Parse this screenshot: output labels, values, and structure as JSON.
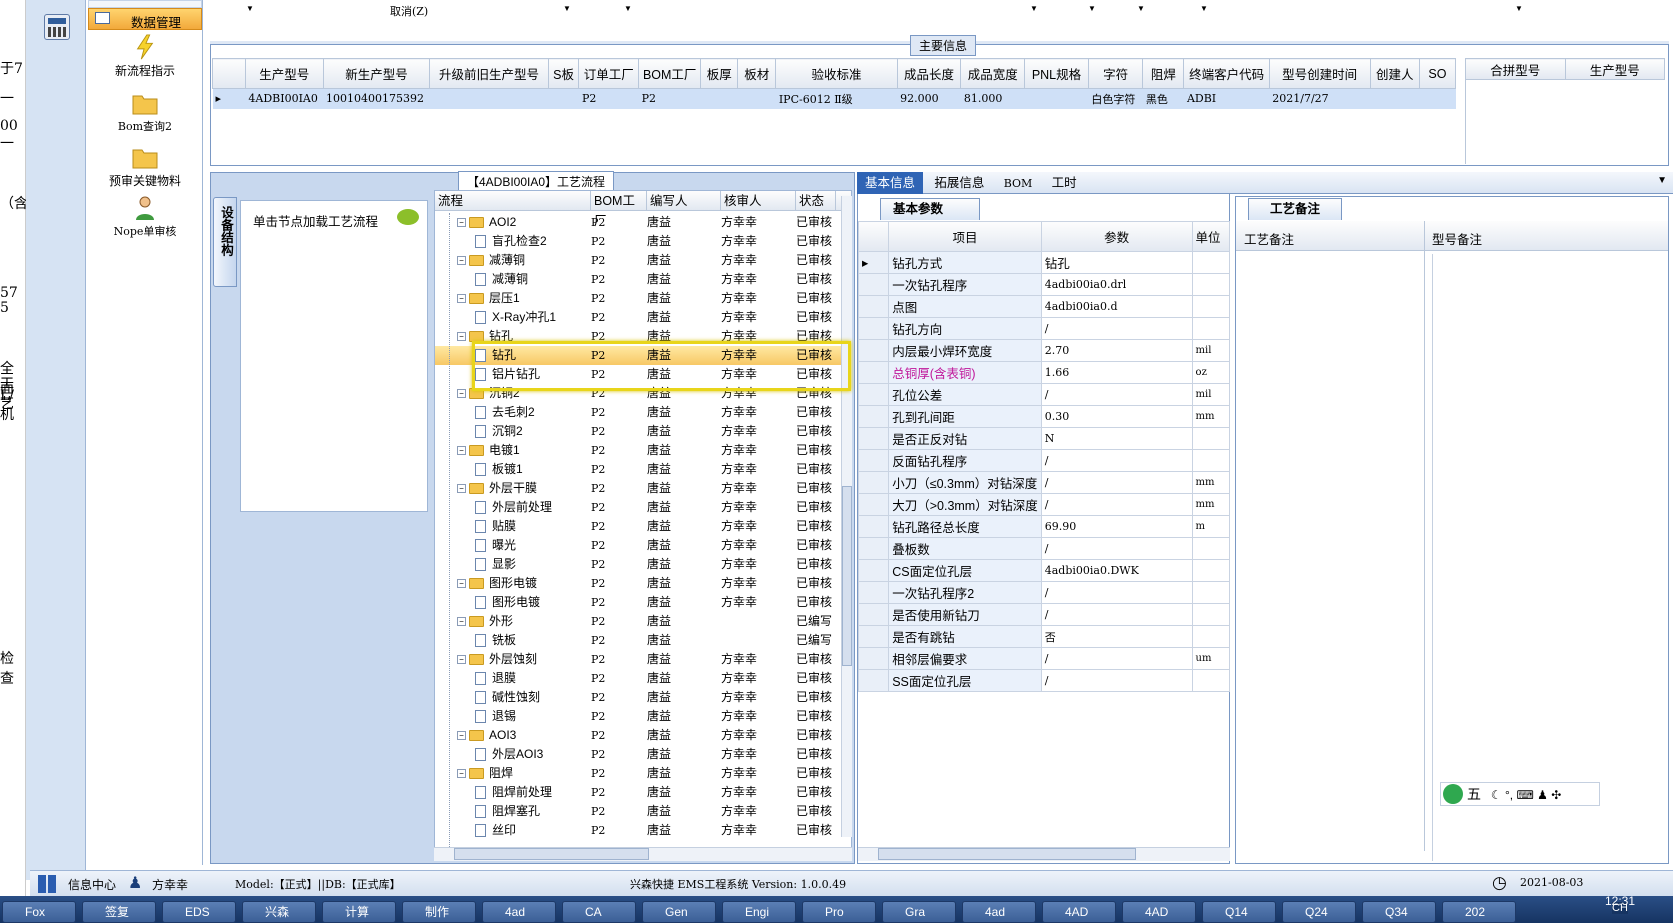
{
  "left_strip": [
    "于7",
    "一",
    "00",
    "一",
    "（含",
    "57",
    "5",
    "全面",
    "工艺",
    "L/机",
    "检查"
  ],
  "nav": {
    "active": "数据管理",
    "items": [
      "新流程指示",
      "Bom查询2",
      "预审关键物料",
      "Nope单审核"
    ]
  },
  "toolbar": {
    "cancel": "取消(Z)"
  },
  "main_info": {
    "title": "主要信息",
    "headers": [
      "生产型号",
      "新生产型号",
      "升级前旧生产型号",
      "S板",
      "订单工厂",
      "BOM工厂",
      "板厚",
      "板材",
      "验收标准",
      "成品长度",
      "成品宽度",
      "PNL规格",
      "字符",
      "阻焊",
      "终端客户代码",
      "型号创建时间",
      "创建人",
      "SO"
    ],
    "row": [
      "4ADBI00IA0",
      "10010400175392",
      "",
      "",
      "P2",
      "P2",
      "",
      "",
      "IPC-6012 Ⅱ级",
      "92.000",
      "81.000",
      "",
      "白色字符",
      "黑色",
      "ADBI",
      "2021/7/27",
      "",
      ""
    ],
    "side_headers": [
      "合拼型号",
      "生产型号"
    ]
  },
  "process": {
    "title": "【4ADBI00IA0】工艺流程",
    "side_tab": "设备结构",
    "hint": "单击节点加载工艺流程",
    "headers": [
      "流程",
      "BOM工厂",
      "编写人",
      "核审人",
      "状态"
    ],
    "rows": [
      {
        "name": "AOI2",
        "level": 1,
        "bom": "P2",
        "writer": "唐益",
        "checker": "方幸幸",
        "status": "已审核"
      },
      {
        "name": "盲孔检查2",
        "level": 2,
        "bom": "P2",
        "writer": "唐益",
        "checker": "方幸幸",
        "status": "已审核"
      },
      {
        "name": "减薄铜",
        "level": 1,
        "bom": "P2",
        "writer": "唐益",
        "checker": "方幸幸",
        "status": "已审核"
      },
      {
        "name": "减薄铜",
        "level": 2,
        "bom": "P2",
        "writer": "唐益",
        "checker": "方幸幸",
        "status": "已审核"
      },
      {
        "name": "层压1",
        "level": 1,
        "bom": "P2",
        "writer": "唐益",
        "checker": "方幸幸",
        "status": "已审核"
      },
      {
        "name": "X-Ray冲孔1",
        "level": 2,
        "bom": "P2",
        "writer": "唐益",
        "checker": "方幸幸",
        "status": "已审核"
      },
      {
        "name": "钻孔",
        "level": 1,
        "bom": "P2",
        "writer": "唐益",
        "checker": "方幸幸",
        "status": "已审核"
      },
      {
        "name": "钻孔",
        "level": 2,
        "bom": "P2",
        "writer": "唐益",
        "checker": "方幸幸",
        "status": "已审核",
        "selected": true
      },
      {
        "name": "铝片钻孔",
        "level": 2,
        "bom": "P2",
        "writer": "唐益",
        "checker": "方幸幸",
        "status": "已审核"
      },
      {
        "name": "沉铜2",
        "level": 1,
        "bom": "P2",
        "writer": "唐益",
        "checker": "方幸幸",
        "status": "已审核"
      },
      {
        "name": "去毛刺2",
        "level": 2,
        "bom": "P2",
        "writer": "唐益",
        "checker": "方幸幸",
        "status": "已审核"
      },
      {
        "name": "沉铜2",
        "level": 2,
        "bom": "P2",
        "writer": "唐益",
        "checker": "方幸幸",
        "status": "已审核"
      },
      {
        "name": "电镀1",
        "level": 1,
        "bom": "P2",
        "writer": "唐益",
        "checker": "方幸幸",
        "status": "已审核"
      },
      {
        "name": "板镀1",
        "level": 2,
        "bom": "P2",
        "writer": "唐益",
        "checker": "方幸幸",
        "status": "已审核"
      },
      {
        "name": "外层干膜",
        "level": 1,
        "bom": "P2",
        "writer": "唐益",
        "checker": "方幸幸",
        "status": "已审核"
      },
      {
        "name": "外层前处理",
        "level": 2,
        "bom": "P2",
        "writer": "唐益",
        "checker": "方幸幸",
        "status": "已审核"
      },
      {
        "name": "贴膜",
        "level": 2,
        "bom": "P2",
        "writer": "唐益",
        "checker": "方幸幸",
        "status": "已审核"
      },
      {
        "name": "曝光",
        "level": 2,
        "bom": "P2",
        "writer": "唐益",
        "checker": "方幸幸",
        "status": "已审核"
      },
      {
        "name": "显影",
        "level": 2,
        "bom": "P2",
        "writer": "唐益",
        "checker": "方幸幸",
        "status": "已审核"
      },
      {
        "name": "图形电镀",
        "level": 1,
        "bom": "P2",
        "writer": "唐益",
        "checker": "方幸幸",
        "status": "已审核"
      },
      {
        "name": "图形电镀",
        "level": 2,
        "bom": "P2",
        "writer": "唐益",
        "checker": "方幸幸",
        "status": "已审核"
      },
      {
        "name": "外形",
        "level": 1,
        "bom": "P2",
        "writer": "唐益",
        "checker": "",
        "status": "已编写"
      },
      {
        "name": "铣板",
        "level": 2,
        "bom": "P2",
        "writer": "唐益",
        "checker": "",
        "status": "已编写"
      },
      {
        "name": "外层蚀刻",
        "level": 1,
        "bom": "P2",
        "writer": "唐益",
        "checker": "方幸幸",
        "status": "已审核"
      },
      {
        "name": "退膜",
        "level": 2,
        "bom": "P2",
        "writer": "唐益",
        "checker": "方幸幸",
        "status": "已审核"
      },
      {
        "name": "碱性蚀刻",
        "level": 2,
        "bom": "P2",
        "writer": "唐益",
        "checker": "方幸幸",
        "status": "已审核"
      },
      {
        "name": "退锡",
        "level": 2,
        "bom": "P2",
        "writer": "唐益",
        "checker": "方幸幸",
        "status": "已审核"
      },
      {
        "name": "AOI3",
        "level": 1,
        "bom": "P2",
        "writer": "唐益",
        "checker": "方幸幸",
        "status": "已审核"
      },
      {
        "name": "外层AOI3",
        "level": 2,
        "bom": "P2",
        "writer": "唐益",
        "checker": "方幸幸",
        "status": "已审核"
      },
      {
        "name": "阻焊",
        "level": 1,
        "bom": "P2",
        "writer": "唐益",
        "checker": "方幸幸",
        "status": "已审核"
      },
      {
        "name": "阻焊前处理",
        "level": 2,
        "bom": "P2",
        "writer": "唐益",
        "checker": "方幸幸",
        "status": "已审核"
      },
      {
        "name": "阻焊塞孔",
        "level": 2,
        "bom": "P2",
        "writer": "唐益",
        "checker": "方幸幸",
        "status": "已审核"
      },
      {
        "name": "丝印",
        "level": 2,
        "bom": "P2",
        "writer": "唐益",
        "checker": "方幸幸",
        "status": "已审核"
      }
    ]
  },
  "detail": {
    "tabs": [
      "基本信息",
      "拓展信息",
      "BOM",
      "工时"
    ],
    "sub_tab": "基本参数",
    "headers": [
      "项目",
      "参数",
      "单位"
    ],
    "rows": [
      {
        "item": "钻孔方式",
        "value": "钻孔",
        "unit": ""
      },
      {
        "item": "一次钻孔程序",
        "value": "4adbi00ia0.drl",
        "unit": ""
      },
      {
        "item": "点图",
        "value": "4adbi00ia0.d",
        "unit": ""
      },
      {
        "item": "钻孔方向",
        "value": "/",
        "unit": ""
      },
      {
        "item": "内层最小焊环宽度",
        "value": "2.70",
        "unit": "mil"
      },
      {
        "item": "总铜厚(含表铜)",
        "value": "1.66",
        "unit": "oz",
        "highlight": true
      },
      {
        "item": "孔位公差",
        "value": "/",
        "unit": "mil"
      },
      {
        "item": "孔到孔间距",
        "value": "0.30",
        "unit": "mm"
      },
      {
        "item": "是否正反对钻",
        "value": "N",
        "unit": ""
      },
      {
        "item": "反面钻孔程序",
        "value": "/",
        "unit": ""
      },
      {
        "item": "小刀（≤0.3mm）对钻深度",
        "value": "/",
        "unit": "mm"
      },
      {
        "item": "大刀（>0.3mm）对钻深度",
        "value": "/",
        "unit": "mm"
      },
      {
        "item": "钻孔路径总长度",
        "value": "69.90",
        "unit": "m"
      },
      {
        "item": "叠板数",
        "value": "/",
        "unit": ""
      },
      {
        "item": "CS面定位孔层",
        "value": "4adbi00ia0.DWK",
        "unit": ""
      },
      {
        "item": "一次钻孔程序2",
        "value": "/",
        "unit": ""
      },
      {
        "item": "是否使用新钻刀",
        "value": "/",
        "unit": ""
      },
      {
        "item": "是否有跳钻",
        "value": "否",
        "unit": ""
      },
      {
        "item": "相邻层偏要求",
        "value": "/",
        "unit": "um"
      },
      {
        "item": "SS面定位孔层",
        "value": "/",
        "unit": ""
      }
    ]
  },
  "remarks": {
    "tab": "工艺备注",
    "col1": "工艺备注",
    "col2": "型号备注"
  },
  "ime": {
    "label": "五"
  },
  "status_bar": {
    "info_center": "信息中心",
    "user": "方幸幸",
    "model": "Model:【正式】||DB:【正式库】",
    "system": "兴森快捷 EMS工程系统 Version: 1.0.0.49",
    "date": "2021-08-03"
  },
  "taskbar": {
    "lang": "CH",
    "time": "12:31",
    "items": [
      "Fox",
      "签复",
      "EDS",
      "兴森",
      "计算",
      "制作",
      "4ad",
      "CA",
      "Gen",
      "Engi",
      "Pro",
      "Gra",
      "4ad",
      "4AD",
      "4AD",
      "Q14",
      "Q24",
      "Q34",
      "202"
    ]
  },
  "colors": {
    "accent": "#f2a93b",
    "selection": "#cfe0f7",
    "highlight_border": "#e8d51a",
    "grid_border": "#7a98c4"
  }
}
